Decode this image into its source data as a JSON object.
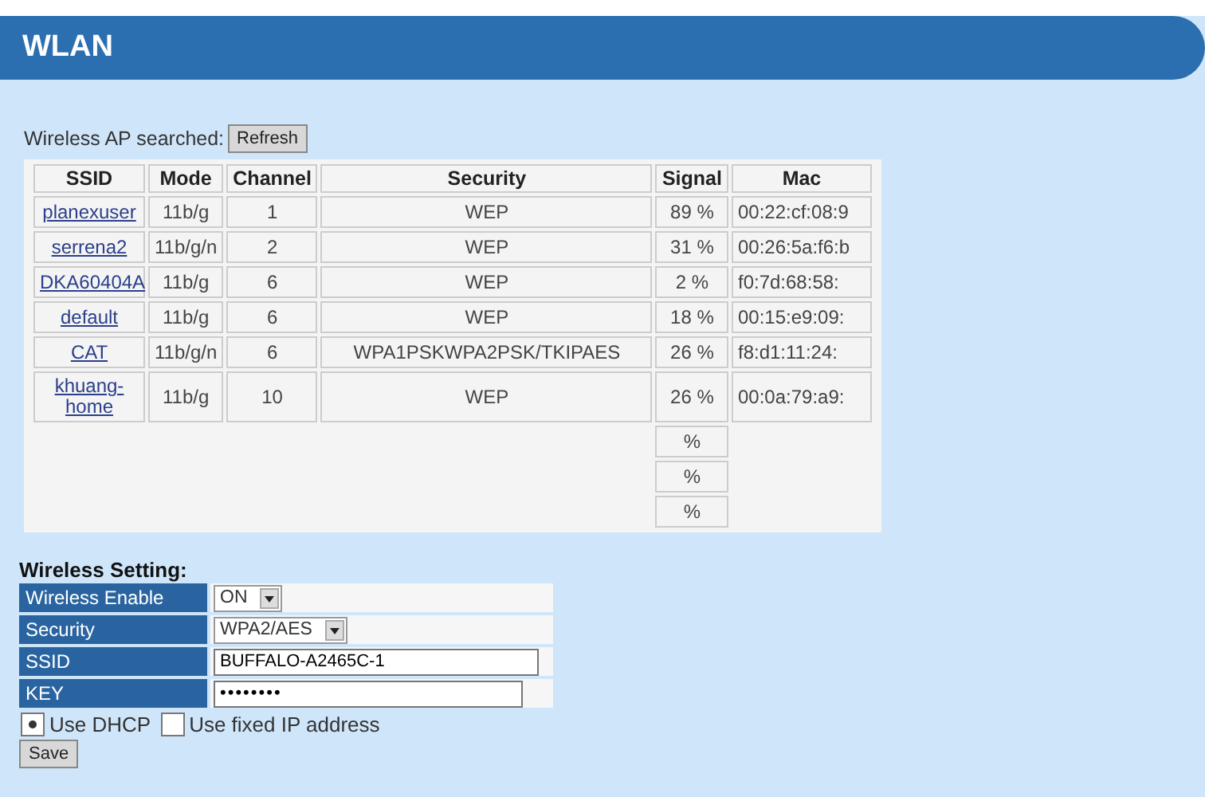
{
  "header": {
    "title": "WLAN"
  },
  "scan": {
    "label": "Wireless AP searched:",
    "button": "Refresh"
  },
  "table": {
    "columns": [
      "SSID",
      "Mode",
      "Channel",
      "Security",
      "Signal",
      "Mac"
    ],
    "rows": [
      {
        "ssid": "planexuser",
        "mode": "11b/g",
        "channel": "1",
        "security": "WEP",
        "signal": "89 %",
        "mac": "00:22:cf:08:9"
      },
      {
        "ssid": "serrena2",
        "mode": "11b/g/n",
        "channel": "2",
        "security": "WEP",
        "signal": "31 %",
        "mac": "00:26:5a:f6:b"
      },
      {
        "ssid": "DKA60404A",
        "mode": "11b/g",
        "channel": "6",
        "security": "WEP",
        "signal": "2 %",
        "mac": "f0:7d:68:58:"
      },
      {
        "ssid": "default",
        "mode": "11b/g",
        "channel": "6",
        "security": "WEP",
        "signal": "18 %",
        "mac": "00:15:e9:09:"
      },
      {
        "ssid": "CAT",
        "mode": "11b/g/n",
        "channel": "6",
        "security": "WPA1PSKWPA2PSK/TKIPAES",
        "signal": "26 %",
        "mac": "f8:d1:11:24:"
      },
      {
        "ssid": "khuang-home",
        "mode": "11b/g",
        "channel": "10",
        "security": "WEP",
        "signal": "26 %",
        "mac": "00:0a:79:a9:"
      },
      {
        "signal": "%"
      },
      {
        "signal": "%"
      },
      {
        "signal": "%"
      }
    ]
  },
  "settings": {
    "title": "Wireless Setting:",
    "rows": [
      {
        "label": "Wireless Enable",
        "kind": "select",
        "value": "ON"
      },
      {
        "label": "Security",
        "kind": "select",
        "value": "WPA2/AES"
      },
      {
        "label": "SSID",
        "kind": "input",
        "value": "BUFFALO-A2465C-1"
      },
      {
        "label": "KEY",
        "kind": "password",
        "value": "••••••••"
      }
    ],
    "ip_mode": [
      {
        "label": "Use DHCP",
        "selected": true
      },
      {
        "label": "Use fixed IP address",
        "selected": false
      }
    ],
    "button": "Save"
  }
}
